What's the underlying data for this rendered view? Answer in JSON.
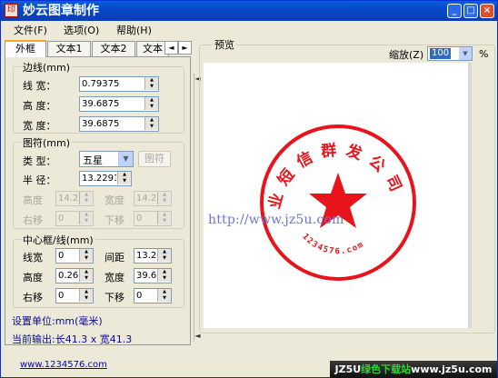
{
  "window": {
    "title": "妙云图章制作",
    "min": "_",
    "max": "□",
    "close": "×"
  },
  "menu": [
    {
      "label": "文件(F)"
    },
    {
      "label": "选项(O)"
    },
    {
      "label": "帮助(H)"
    }
  ],
  "tabs": [
    {
      "label": "外框"
    },
    {
      "label": "文本1"
    },
    {
      "label": "文本2"
    },
    {
      "label": "文本"
    }
  ],
  "tab_nav": {
    "prev": "◄",
    "next": "►"
  },
  "border_group": {
    "title": "边线(mm)",
    "line_width_label": "线  宽：",
    "line_width": "0.79375",
    "height_label": "高  度：",
    "height": "39.6875",
    "width_label": "宽  度：",
    "width": "39.6875"
  },
  "symbol_group": {
    "title": "图符(mm)",
    "type_label": "类  型：",
    "type_value": "五星",
    "pick_button": "图符",
    "radius_label": "半  径：",
    "radius": "13.2291",
    "height_label": "高度",
    "height": "14.2",
    "width_label": "宽度",
    "width": "14.2",
    "right_label": "右移",
    "right": "0",
    "down_label": "下移",
    "down": "0"
  },
  "center_group": {
    "title": "中心框/线(mm)",
    "line_width_label": "线宽",
    "line_width": "0",
    "spacing_label": "间距",
    "spacing": "13.2",
    "height_label": "高度",
    "height": "0.26",
    "width_label": "宽度",
    "width": "39.6",
    "right_label": "右移",
    "right": "0",
    "down_label": "下移",
    "down": "0"
  },
  "unit_text": "设置单位:mm(毫米)",
  "output_text": "当前输出:长41.3 x 宽41.3",
  "site_link": "www.1234576.com",
  "preview": {
    "label": "预览",
    "zoom_label": "缩放(Z)",
    "zoom_value": "100",
    "percent": "%"
  },
  "stamp": {
    "color": "#e8141b",
    "arc_text": "业短信群发公司",
    "inner_text": "1234576.com"
  },
  "watermark": "http://www.jz5u.com",
  "badge": {
    "part1": "JZ5U",
    "part2": "绿色下载站",
    "part3": "www.jz5u.com"
  }
}
